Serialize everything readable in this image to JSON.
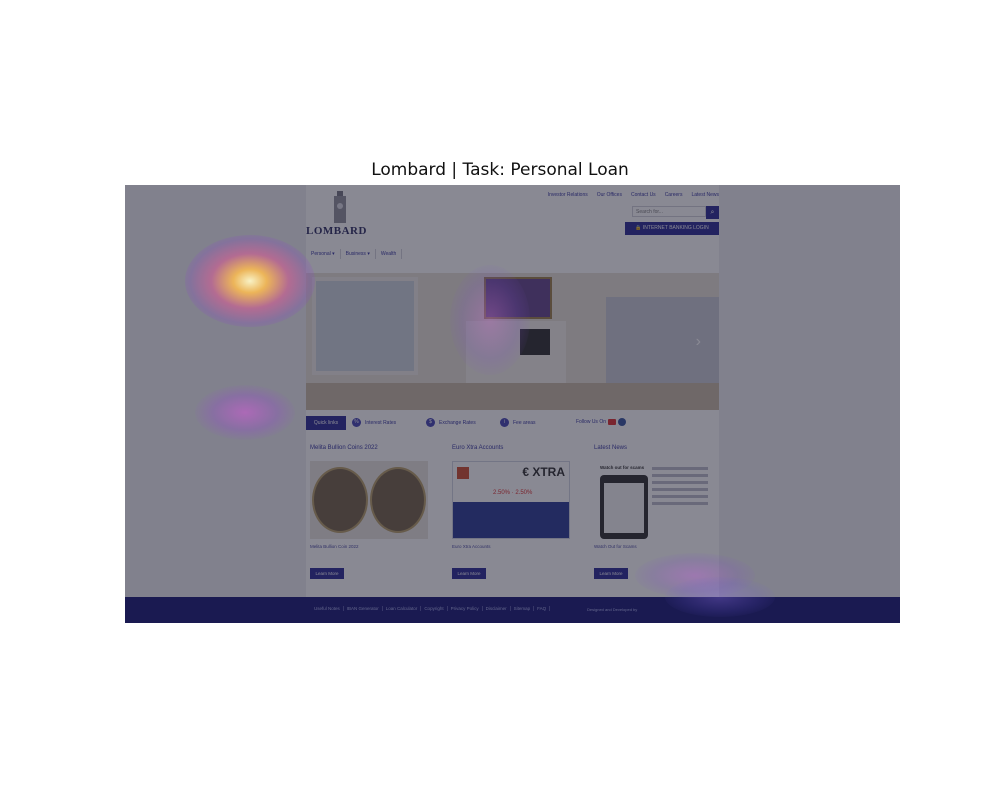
{
  "figure": {
    "title": "Lombard | Task: Personal Loan"
  },
  "site": {
    "top_links": [
      "Investor Relations",
      "Our Offices",
      "Contact Us",
      "Careers",
      "Latest News"
    ],
    "logo_text": "LOMBARD",
    "search": {
      "placeholder": "Search for...",
      "icon": "search-icon"
    },
    "internet_banking_label": "INTERNET BANKING LOGIN",
    "nav": [
      "Personal ▾",
      "Business ▾",
      "Wealth"
    ],
    "quicklinks": {
      "label": "Quick links",
      "items": [
        "Interest Rates",
        "Exchange Rates",
        "Fee areas"
      ],
      "follow_label": "Follow Us On"
    },
    "columns": [
      {
        "title": "Melita Bullion Coins 2022",
        "caption": "Melita Bullion Coin 2022",
        "button": "Learn More"
      },
      {
        "title": "Euro Xtra Accounts",
        "caption": "Euro Xtra Accounts",
        "button": "Learn More",
        "flyer_badge": "€ XTRA",
        "flyer_rate": "2.50% · 2.50%"
      },
      {
        "title": "Latest News",
        "caption": "Watch Out for Scams",
        "button": "Learn More",
        "news_heading": "Watch out for scams"
      }
    ],
    "footer": {
      "links": [
        "Useful Notes",
        "IBAN Generator",
        "Loan Calculator",
        "Copyright",
        "Privacy Policy",
        "Disclaimer",
        "Sitemap",
        "FAQ"
      ],
      "credit": "Designed and Developed by"
    }
  },
  "colors": {
    "brand_blue": "#1d1d8f",
    "footer_blue": "#0b0b6e",
    "overlay": "#28283a"
  }
}
